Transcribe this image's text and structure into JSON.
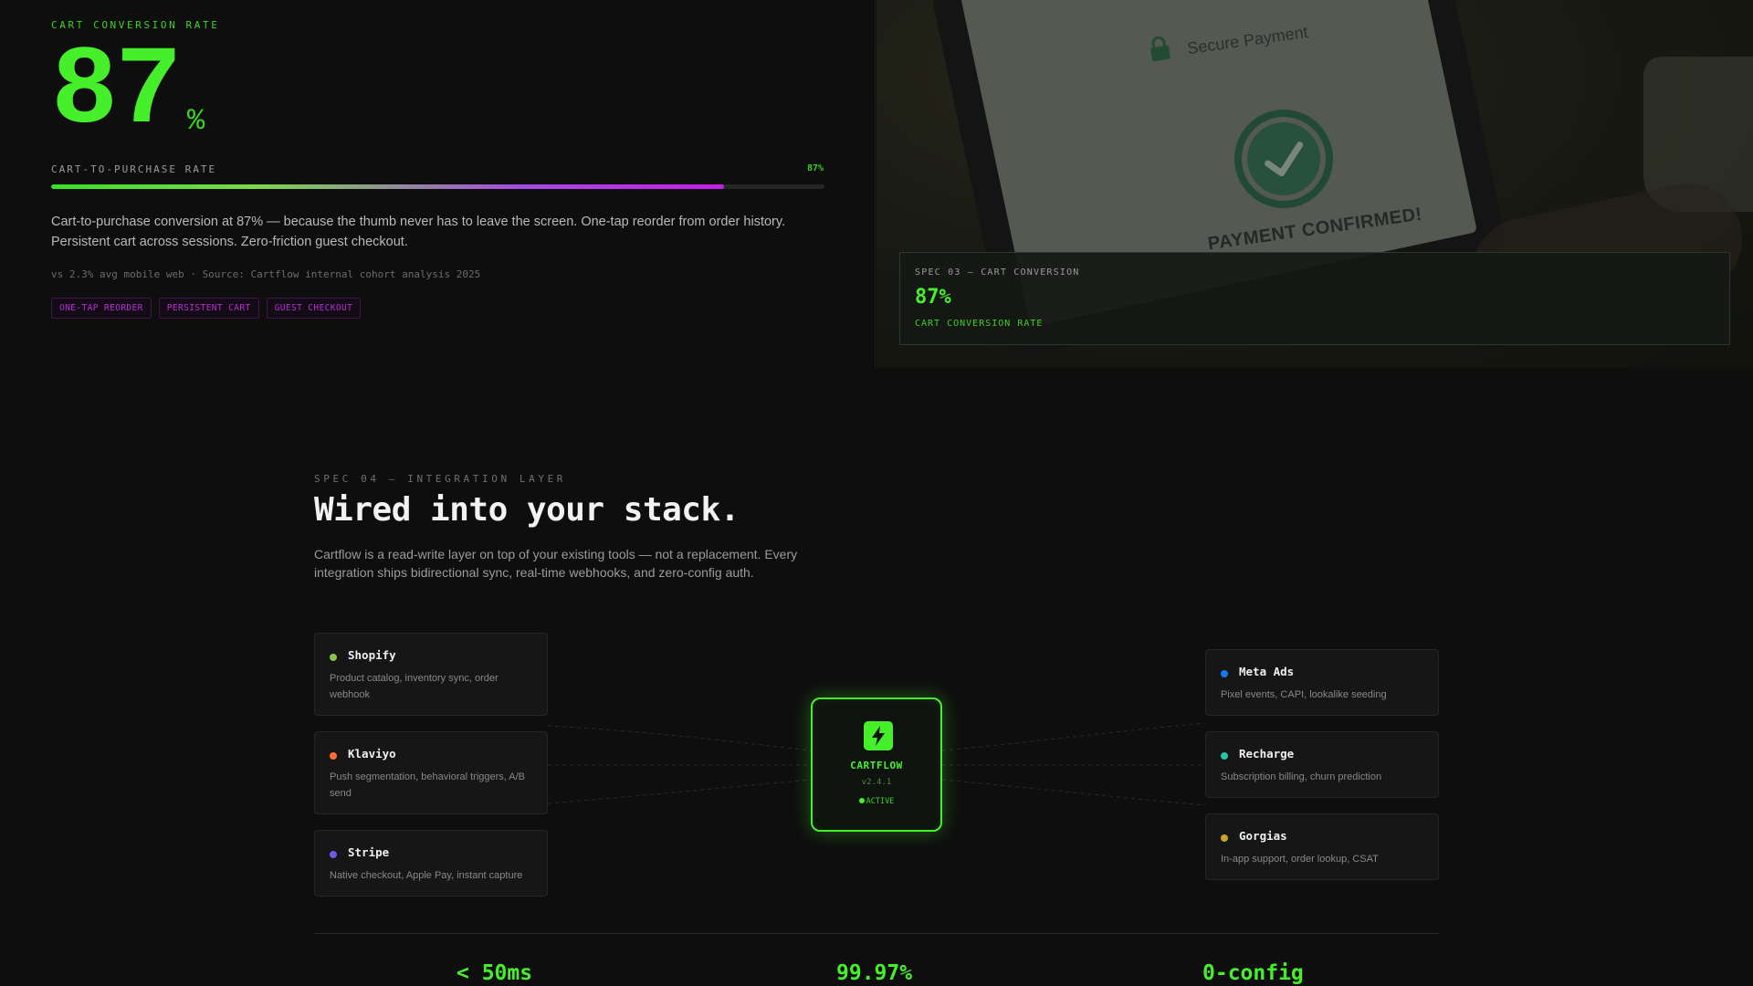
{
  "conversion": {
    "eyebrow": "CART CONVERSION RATE",
    "big_value": "87",
    "big_unit": "%",
    "bar_label": "CART-TO-PURCHASE RATE",
    "bar_value_text": "87%",
    "bar_fraction": 0.87,
    "description": "Cart-to-purchase conversion at 87% — because the thumb never has to leave the screen. One-tap reorder from order history. Persistent cart across sessions. Zero-friction guest checkout.",
    "source": "vs 2.3% avg mobile web · Source: Cartflow internal cohort analysis 2025",
    "tags": [
      "ONE-TAP REORDER",
      "PERSISTENT CART",
      "GUEST CHECKOUT"
    ]
  },
  "photo": {
    "screen_title": "Secure Payment",
    "confirmed_text": "PAYMENT CONFIRMED!"
  },
  "spec_card": {
    "eyebrow": "SPEC 03 — CART CONVERSION",
    "value": "87%",
    "label": "CART CONVERSION RATE"
  },
  "integration": {
    "eyebrow": "SPEC 04 — INTEGRATION LAYER",
    "title": "Wired into your stack.",
    "description": "Cartflow is a read-write layer on top of your existing tools — not a replacement. Every integration ships bidirectional sync, real-time webhooks, and zero-config auth.",
    "left": [
      {
        "name": "Shopify",
        "desc": "Product catalog, inventory sync, order webhook",
        "color": "#8bc34a"
      },
      {
        "name": "Klaviyo",
        "desc": "Push segmentation, behavioral triggers, A/B send",
        "color": "#ff6b35"
      },
      {
        "name": "Stripe",
        "desc": "Native checkout, Apple Pay, instant capture",
        "color": "#6c5ce7"
      }
    ],
    "right": [
      {
        "name": "Meta Ads",
        "desc": "Pixel events, CAPI, lookalike seeding",
        "color": "#1877f2"
      },
      {
        "name": "Recharge",
        "desc": "Subscription billing, churn prediction",
        "color": "#26c6a6"
      },
      {
        "name": "Gorgias",
        "desc": "In-app support, order lookup, CSAT",
        "color": "#c9a227"
      }
    ],
    "hub": {
      "name": "CARTFLOW",
      "version": "v2.4.1",
      "status": "ACTIVE",
      "icon": "lightning-bolt-icon"
    }
  },
  "stats": [
    "< 50ms",
    "99.97%",
    "0-config"
  ],
  "colors": {
    "accent": "#45f02a",
    "magenta": "#c51ee8",
    "background": "#0e0e0e"
  }
}
